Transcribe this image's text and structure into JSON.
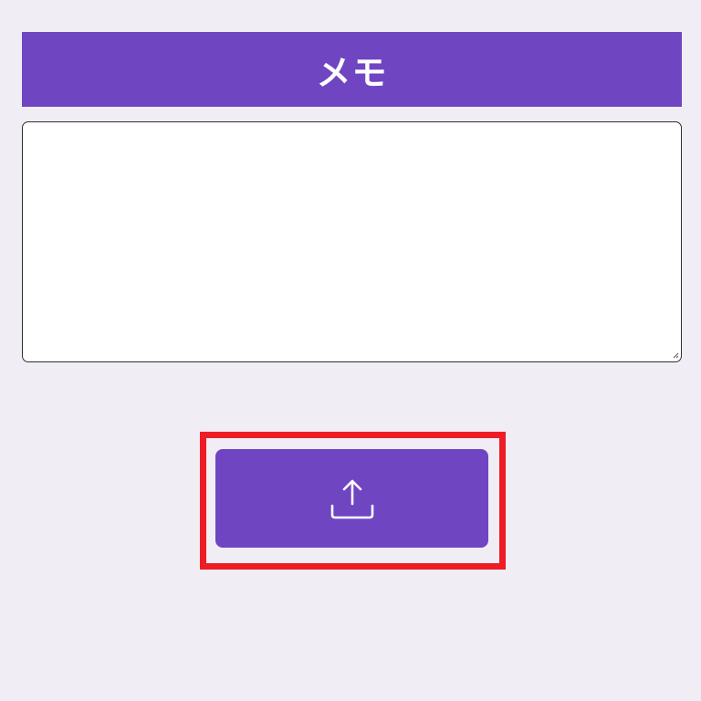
{
  "header": {
    "title": "メモ"
  },
  "memo": {
    "value": "",
    "placeholder": ""
  },
  "upload_button": {
    "icon": "upload-icon"
  },
  "colors": {
    "accent": "#6f45c2",
    "background": "#f0edf4",
    "highlight": "#ee1c25"
  }
}
